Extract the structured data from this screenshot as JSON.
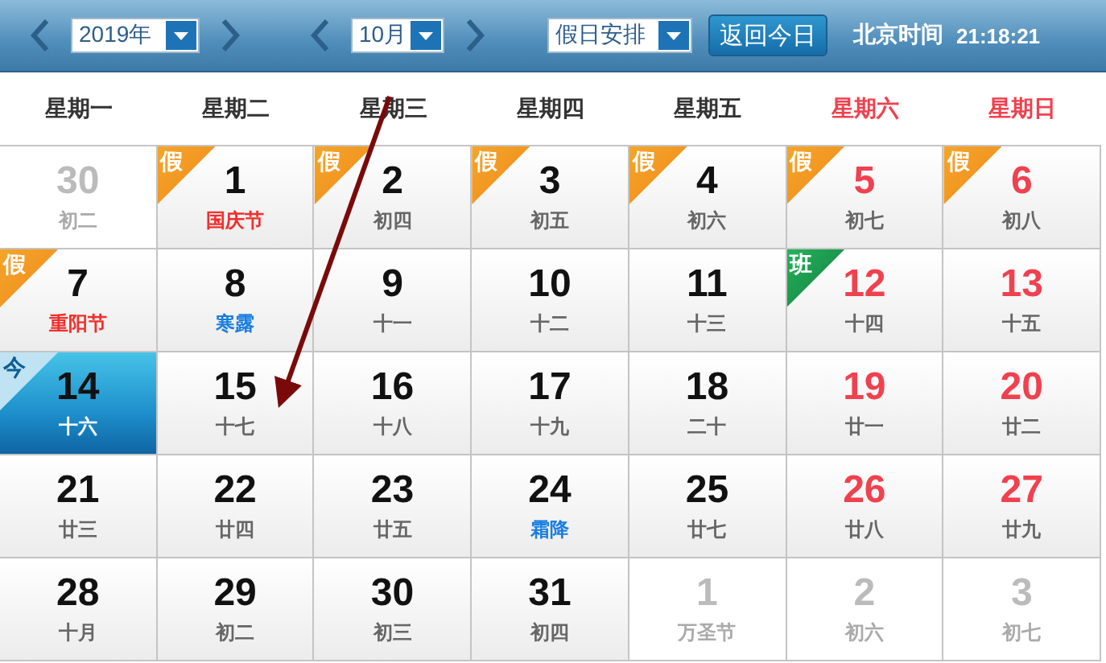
{
  "toolbar": {
    "year": "2019年",
    "month": "10月",
    "holiday_select": "假日安排",
    "today_button": "返回今日",
    "clock_label": "北京时间",
    "clock_time": "21:18:21"
  },
  "weekdays": [
    {
      "label": "星期一",
      "weekend": false
    },
    {
      "label": "星期二",
      "weekend": false
    },
    {
      "label": "星期三",
      "weekend": false
    },
    {
      "label": "星期四",
      "weekend": false
    },
    {
      "label": "星期五",
      "weekend": false
    },
    {
      "label": "星期六",
      "weekend": true
    },
    {
      "label": "星期日",
      "weekend": true
    }
  ],
  "cells": [
    {
      "day": "30",
      "sub": "初二",
      "other_month": true,
      "selected": false
    },
    {
      "day": "1",
      "sub": "国庆节",
      "kind": "festival",
      "other_month": false,
      "weekend": false,
      "selected": false,
      "badge": {
        "kind": "holiday",
        "text": "假"
      }
    },
    {
      "day": "2",
      "sub": "初四",
      "kind": "lunar",
      "other_month": false,
      "weekend": false,
      "selected": false,
      "badge": {
        "kind": "holiday",
        "text": "假"
      }
    },
    {
      "day": "3",
      "sub": "初五",
      "kind": "lunar",
      "other_month": false,
      "weekend": false,
      "selected": false,
      "badge": {
        "kind": "holiday",
        "text": "假"
      }
    },
    {
      "day": "4",
      "sub": "初六",
      "kind": "lunar",
      "other_month": false,
      "weekend": false,
      "selected": false,
      "badge": {
        "kind": "holiday",
        "text": "假"
      }
    },
    {
      "day": "5",
      "sub": "初七",
      "kind": "lunar",
      "other_month": false,
      "weekend": true,
      "selected": false,
      "badge": {
        "kind": "holiday",
        "text": "假"
      }
    },
    {
      "day": "6",
      "sub": "初八",
      "kind": "lunar",
      "other_month": false,
      "weekend": true,
      "selected": false,
      "badge": {
        "kind": "holiday",
        "text": "假"
      }
    },
    {
      "day": "7",
      "sub": "重阳节",
      "kind": "festival",
      "other_month": false,
      "weekend": false,
      "selected": false,
      "badge": {
        "kind": "holiday",
        "text": "假"
      }
    },
    {
      "day": "8",
      "sub": "寒露",
      "kind": "term",
      "other_month": false,
      "weekend": false,
      "selected": false
    },
    {
      "day": "9",
      "sub": "十一",
      "kind": "lunar",
      "other_month": false,
      "weekend": false,
      "selected": false
    },
    {
      "day": "10",
      "sub": "十二",
      "kind": "lunar",
      "other_month": false,
      "weekend": false,
      "selected": false
    },
    {
      "day": "11",
      "sub": "十三",
      "kind": "lunar",
      "other_month": false,
      "weekend": false,
      "selected": false
    },
    {
      "day": "12",
      "sub": "十四",
      "kind": "lunar",
      "other_month": false,
      "weekend": true,
      "selected": false,
      "badge": {
        "kind": "work",
        "text": "班"
      }
    },
    {
      "day": "13",
      "sub": "十五",
      "kind": "lunar",
      "other_month": false,
      "weekend": true,
      "selected": false
    },
    {
      "day": "14",
      "sub": "十六",
      "other_month": false,
      "weekend": false,
      "selected": true,
      "badge": {
        "kind": "today",
        "text": "今"
      }
    },
    {
      "day": "15",
      "sub": "十七",
      "kind": "lunar",
      "other_month": false,
      "weekend": false,
      "selected": false
    },
    {
      "day": "16",
      "sub": "十八",
      "kind": "lunar",
      "other_month": false,
      "weekend": false,
      "selected": false
    },
    {
      "day": "17",
      "sub": "十九",
      "kind": "lunar",
      "other_month": false,
      "weekend": false,
      "selected": false
    },
    {
      "day": "18",
      "sub": "二十",
      "kind": "lunar",
      "other_month": false,
      "weekend": false,
      "selected": false
    },
    {
      "day": "19",
      "sub": "廿一",
      "kind": "lunar",
      "other_month": false,
      "weekend": true,
      "selected": false
    },
    {
      "day": "20",
      "sub": "廿二",
      "kind": "lunar",
      "other_month": false,
      "weekend": true,
      "selected": false
    },
    {
      "day": "21",
      "sub": "廿三",
      "kind": "lunar",
      "other_month": false,
      "weekend": false,
      "selected": false
    },
    {
      "day": "22",
      "sub": "廿四",
      "kind": "lunar",
      "other_month": false,
      "weekend": false,
      "selected": false
    },
    {
      "day": "23",
      "sub": "廿五",
      "kind": "lunar",
      "other_month": false,
      "weekend": false,
      "selected": false
    },
    {
      "day": "24",
      "sub": "霜降",
      "kind": "term",
      "other_month": false,
      "weekend": false,
      "selected": false
    },
    {
      "day": "25",
      "sub": "廿七",
      "kind": "lunar",
      "other_month": false,
      "weekend": false,
      "selected": false
    },
    {
      "day": "26",
      "sub": "廿八",
      "kind": "lunar",
      "other_month": false,
      "weekend": true,
      "selected": false
    },
    {
      "day": "27",
      "sub": "廿九",
      "kind": "lunar",
      "other_month": false,
      "weekend": true,
      "selected": false
    },
    {
      "day": "28",
      "sub": "十月",
      "kind": "lunar",
      "other_month": false,
      "weekend": false,
      "selected": false
    },
    {
      "day": "29",
      "sub": "初二",
      "kind": "lunar",
      "other_month": false,
      "weekend": false,
      "selected": false
    },
    {
      "day": "30",
      "sub": "初三",
      "kind": "lunar",
      "other_month": false,
      "weekend": false,
      "selected": false
    },
    {
      "day": "31",
      "sub": "初四",
      "kind": "lunar",
      "other_month": false,
      "weekend": false,
      "selected": false
    },
    {
      "day": "1",
      "sub": "万圣节",
      "other_month": true,
      "selected": false
    },
    {
      "day": "2",
      "sub": "初六",
      "other_month": true,
      "selected": false
    },
    {
      "day": "3",
      "sub": "初七",
      "other_month": true,
      "selected": false
    }
  ]
}
